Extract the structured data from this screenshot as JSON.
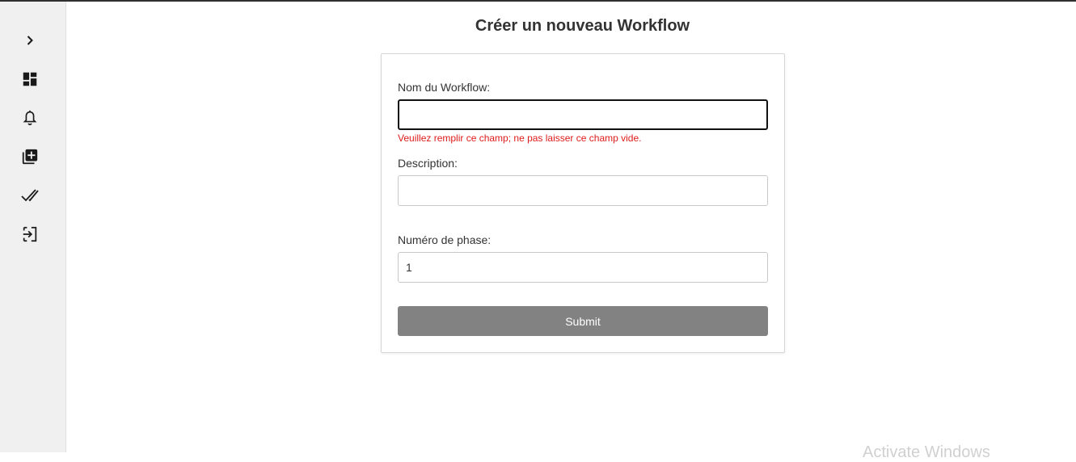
{
  "sidebar": {
    "items": [
      {
        "name": "expand",
        "icon": "chevron-right-icon"
      },
      {
        "name": "dashboard",
        "icon": "dashboard-icon"
      },
      {
        "name": "notifications",
        "icon": "bell-icon"
      },
      {
        "name": "add-workflow",
        "icon": "library-add-icon"
      },
      {
        "name": "tasks",
        "icon": "done-all-icon"
      },
      {
        "name": "logout",
        "icon": "logout-icon"
      }
    ]
  },
  "page": {
    "title": "Créer un nouveau Workflow"
  },
  "form": {
    "name_label": "Nom du Workflow:",
    "name_value": "",
    "name_error": "Veuillez remplir ce champ; ne pas laisser ce champ vide.",
    "description_label": "Description:",
    "description_value": "",
    "phase_label": "Numéro de phase:",
    "phase_value": "1",
    "submit_label": "Submit"
  },
  "watermark": "Activate Windows",
  "colors": {
    "error": "#e01b1b",
    "submit_bg": "#828282",
    "sidebar_bg": "#f0f0f0"
  }
}
